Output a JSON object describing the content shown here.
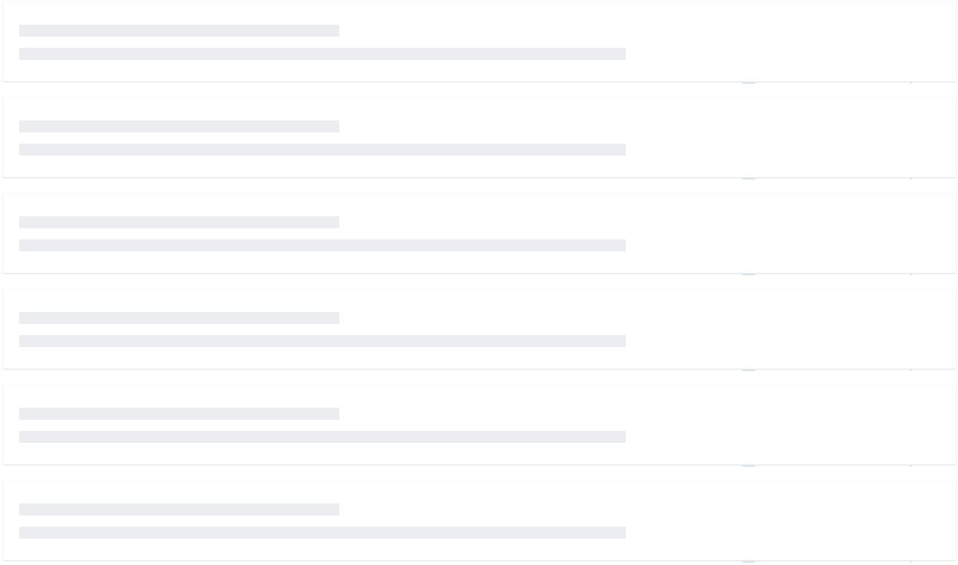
{
  "skeleton": {
    "state": "loading",
    "cards": [
      {
        "id": 1
      },
      {
        "id": 2
      },
      {
        "id": 3
      },
      {
        "id": 4
      },
      {
        "id": 5
      },
      {
        "id": 6
      }
    ]
  },
  "colors": {
    "background": "#ffffff",
    "placeholder": "#ebedf0",
    "shadow": "rgba(0,0,0,0.12)"
  }
}
